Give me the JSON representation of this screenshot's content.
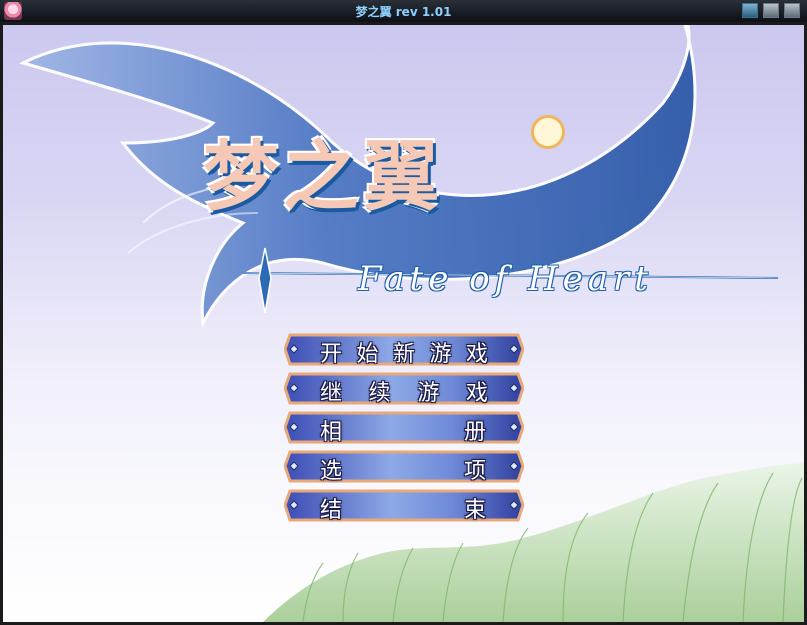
{
  "window": {
    "title": "梦之翼 rev 1.01"
  },
  "logo": {
    "chinese": "梦之翼",
    "english": "Fate of Heart"
  },
  "menu": {
    "items": [
      {
        "chars": [
          "开",
          "始",
          "新",
          "游",
          "戏"
        ]
      },
      {
        "chars": [
          "继",
          "续",
          "游",
          "戏"
        ]
      },
      {
        "left": "相",
        "right": "册"
      },
      {
        "left": "选",
        "right": "项"
      },
      {
        "left": "结",
        "right": "束"
      }
    ]
  }
}
